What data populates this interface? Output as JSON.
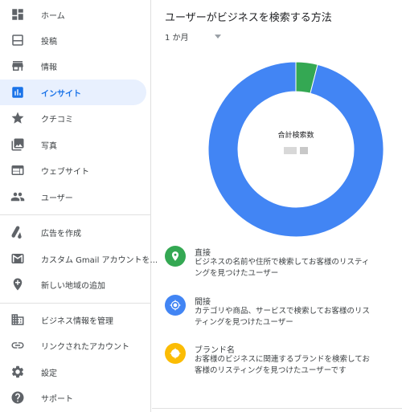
{
  "sidebar": {
    "items": [
      {
        "label": "ホーム",
        "icon": "dashboard-icon",
        "active": false
      },
      {
        "label": "投稿",
        "icon": "posts-icon",
        "active": false
      },
      {
        "label": "情報",
        "icon": "storefront-icon",
        "active": false
      },
      {
        "label": "インサイト",
        "icon": "insights-bar-chart-icon",
        "active": true
      },
      {
        "label": "クチコミ",
        "icon": "star-icon",
        "active": false
      },
      {
        "label": "写真",
        "icon": "photos-icon",
        "active": false
      },
      {
        "label": "ウェブサイト",
        "icon": "website-icon",
        "active": false
      },
      {
        "label": "ユーザー",
        "icon": "people-icon",
        "active": false
      },
      {
        "label": "広告を作成",
        "icon": "google-ads-icon",
        "active": false
      },
      {
        "label": "カスタム Gmail アカウントを...",
        "icon": "gmail-icon",
        "active": false
      },
      {
        "label": "新しい地域の追加",
        "icon": "add-location-icon",
        "active": false
      },
      {
        "label": "ビジネス情報を管理",
        "icon": "business-icon",
        "active": false
      },
      {
        "label": "リンクされたアカウント",
        "icon": "link-icon",
        "active": false
      },
      {
        "label": "設定",
        "icon": "settings-icon",
        "active": false
      },
      {
        "label": "サポート",
        "icon": "help-icon",
        "active": false
      }
    ]
  },
  "main": {
    "title": "ユーザーがビジネスを検索する方法",
    "period": "1 か月",
    "center_label": "合計検索数"
  },
  "chart_data": {
    "type": "pie",
    "donut": true,
    "series": [
      {
        "name": "直接",
        "value": 4,
        "color": "#34a853"
      },
      {
        "name": "間接",
        "value": 96,
        "color": "#4285f4"
      }
    ]
  },
  "legend": [
    {
      "title": "直接",
      "description": "ビジネスの名前や住所で検索してお客様のリスティングを見つけたユーザー",
      "color": "#34a853",
      "icon": "location-pin-icon"
    },
    {
      "title": "間接",
      "description": "カテゴリや商品、サービスで検索してお客様のリスティングを見つけたユーザー",
      "color": "#4285f4",
      "icon": "discovery-icon"
    },
    {
      "title": "ブランド名",
      "description": "お客様のビジネスに関連するブランドを検索してお客様のリスティングを見つけたユーザーです",
      "color": "#fbbc04",
      "icon": "brand-icon"
    }
  ]
}
